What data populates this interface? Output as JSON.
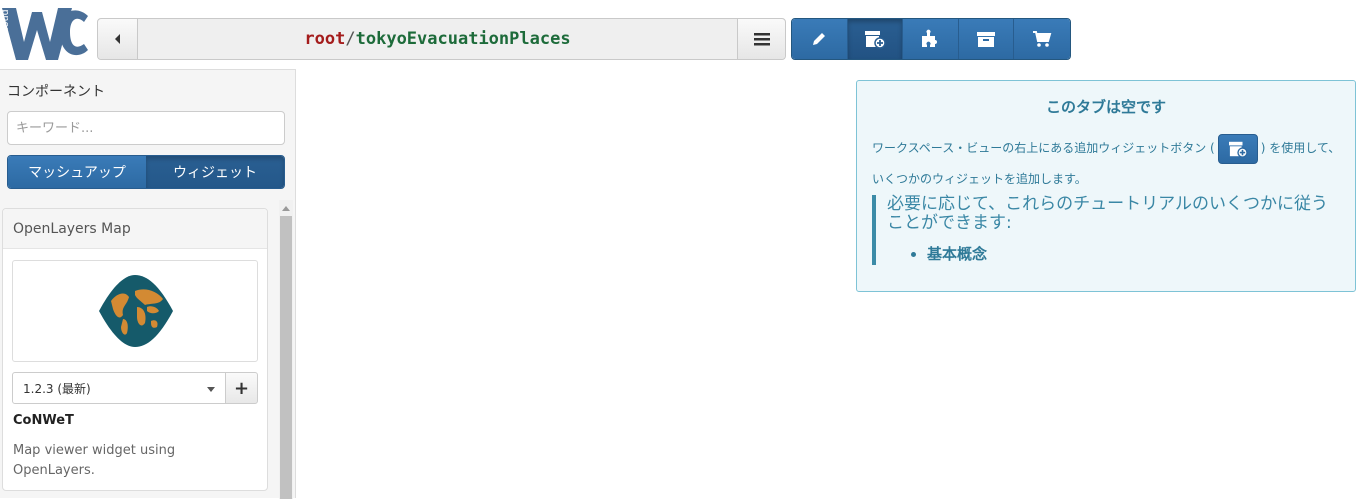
{
  "logo": {
    "vertical_text": "Wirecloud",
    "icon": "wirecloud-logo"
  },
  "header": {
    "path_owner": "root",
    "path_separator": "/",
    "path_name": "tokyoEvacuationPlaces",
    "back_icon": "chevron-left-icon",
    "menu_icon": "hamburger-icon"
  },
  "toolbar": {
    "buttons": [
      {
        "icon": "pencil-icon",
        "active": false
      },
      {
        "icon": "add-widget-icon",
        "active": true
      },
      {
        "icon": "puzzle-icon",
        "active": false
      },
      {
        "icon": "archive-icon",
        "active": false
      },
      {
        "icon": "cart-icon",
        "active": false
      }
    ],
    "active_color": "#225283",
    "button_color": "#3172ae"
  },
  "sidebar": {
    "title": "コンポーネント",
    "search_placeholder": "キーワード...",
    "tabs": [
      {
        "label": "マッシュアップ",
        "active": false
      },
      {
        "label": "ウィジェット",
        "active": true
      }
    ],
    "component": {
      "name": "OpenLayers Map",
      "version": "1.2.3 (最新)",
      "add_label": "+",
      "vendor": "CoNWeT",
      "description": "Map viewer widget using OpenLayers."
    }
  },
  "info": {
    "title": "このタブは空です",
    "p1_before": "ワークスペース・ビューの右上にある追加ウィジェットボタン (",
    "p1_after": ") を使用して、いくつかのウィジェットを追加します。",
    "quote_text": "必要に応じて、これらのチュートリアルのいくつかに従うことができます:",
    "links": [
      "基本概念"
    ],
    "accent": "#31708f",
    "background": "#eef7fa"
  }
}
